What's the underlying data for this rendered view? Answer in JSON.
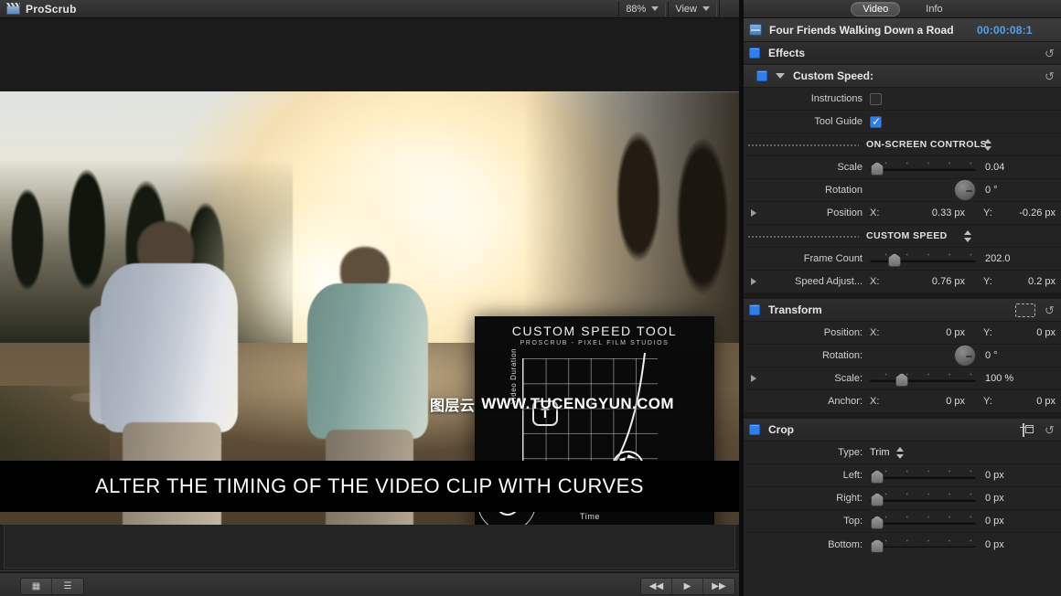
{
  "viewer": {
    "app_title": "ProScrub",
    "app_icon": "film-clapper-icon",
    "zoom_level": "88%",
    "view_menu": "View",
    "overlay": {
      "title": "CUSTOM SPEED TOOL",
      "subtitle": "PROSCRUB - PIXEL FILM STUDIOS",
      "y_axis_label": "Video Duration",
      "x_axis_label": "Time",
      "tool_badge": "T"
    },
    "watermark_cn": "图层云",
    "watermark_url": "WWW.TUCENGYUN.COM",
    "caption": "ALTER THE TIMING OF THE VIDEO CLIP WITH CURVES"
  },
  "inspector": {
    "tabs": [
      {
        "label": "Video",
        "active": true
      },
      {
        "label": "Info",
        "active": false
      }
    ],
    "clip": {
      "name": "Four Friends Walking Down a Road",
      "timecode": "00:00:08:1",
      "accent_color": "#4ea2f5"
    },
    "sections": [
      {
        "title": "Effects",
        "reset_icon": "reset-arrow-icon"
      },
      {
        "title": "Custom Speed:",
        "reset_icon": "reset-arrow-icon",
        "rows": {
          "instructions_label": "Instructions",
          "instructions_checked": false,
          "tool_guide_label": "Tool Guide",
          "tool_guide_checked": true,
          "group_onscreen": "ON-SCREEN CONTROLS",
          "scale_label": "Scale",
          "scale_value": "0.04",
          "rotation_label": "Rotation",
          "rotation_value": "0 °",
          "position_label": "Position",
          "position_x_key": "X:",
          "position_x": "0.33 px",
          "position_y_key": "Y:",
          "position_y": "-0.26 px",
          "group_custom": "CUSTOM SPEED",
          "frame_count_label": "Frame Count",
          "frame_count_value": "202.0",
          "speed_adjust_label": "Speed Adjust...",
          "speed_x_key": "X:",
          "speed_x": "0.76 px",
          "speed_y_key": "Y:",
          "speed_y": "0.2 px"
        }
      },
      {
        "title": "Transform",
        "icon": "transform-handles-icon",
        "reset_icon": "reset-arrow-icon",
        "rows": {
          "position_label": "Position:",
          "position_x_key": "X:",
          "position_x": "0 px",
          "position_y_key": "Y:",
          "position_y": "0 px",
          "rotation_label": "Rotation:",
          "rotation_value": "0 °",
          "scale_label": "Scale:",
          "scale_value": "100 %",
          "anchor_label": "Anchor:",
          "anchor_x_key": "X:",
          "anchor_x": "0 px",
          "anchor_y_key": "Y:",
          "anchor_y": "0 px"
        }
      },
      {
        "title": "Crop",
        "icon": "crop-icon",
        "reset_icon": "reset-arrow-icon",
        "rows": {
          "type_label": "Type:",
          "type_value": "Trim",
          "left_label": "Left:",
          "left_value": "0 px",
          "right_label": "Right:",
          "right_value": "0 px",
          "top_label": "Top:",
          "top_value": "0 px",
          "bottom_label": "Bottom:",
          "bottom_value": "0 px"
        }
      }
    ]
  }
}
